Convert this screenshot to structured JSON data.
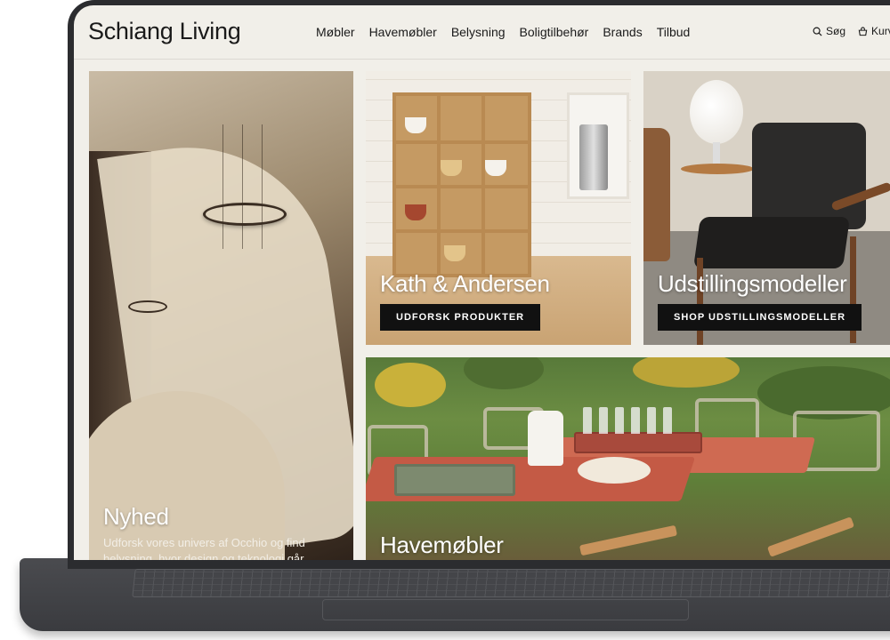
{
  "brand": {
    "logo_text": "Schiang Living"
  },
  "nav": [
    {
      "label": "Møbler"
    },
    {
      "label": "Havemøbler"
    },
    {
      "label": "Belysning"
    },
    {
      "label": "Boligtilbehør"
    },
    {
      "label": "Brands"
    },
    {
      "label": "Tilbud"
    }
  ],
  "utilities": {
    "search_label": "Søg",
    "cart_label": "Kurv"
  },
  "tiles": {
    "nyhed": {
      "title": "Nyhed",
      "description": "Udforsk vores univers af Occhio og find belysning, hvor design og teknologi går hånd i"
    },
    "kath": {
      "title": "Kath & Andersen",
      "button_label": "UDFORSK PRODUKTER"
    },
    "udstillingsmodeller": {
      "title": "Udstillingsmodeller",
      "button_label": "SHOP UDSTILLINGSMODELLER"
    },
    "havemobler": {
      "title": "Havemøbler"
    }
  },
  "colors": {
    "page_background": "#f1efe9",
    "button_background": "#111111",
    "text_primary": "#1a1a1a",
    "device_frame": "#2b2c2f"
  },
  "icons": {
    "search": "search-icon",
    "cart": "cart-icon"
  }
}
